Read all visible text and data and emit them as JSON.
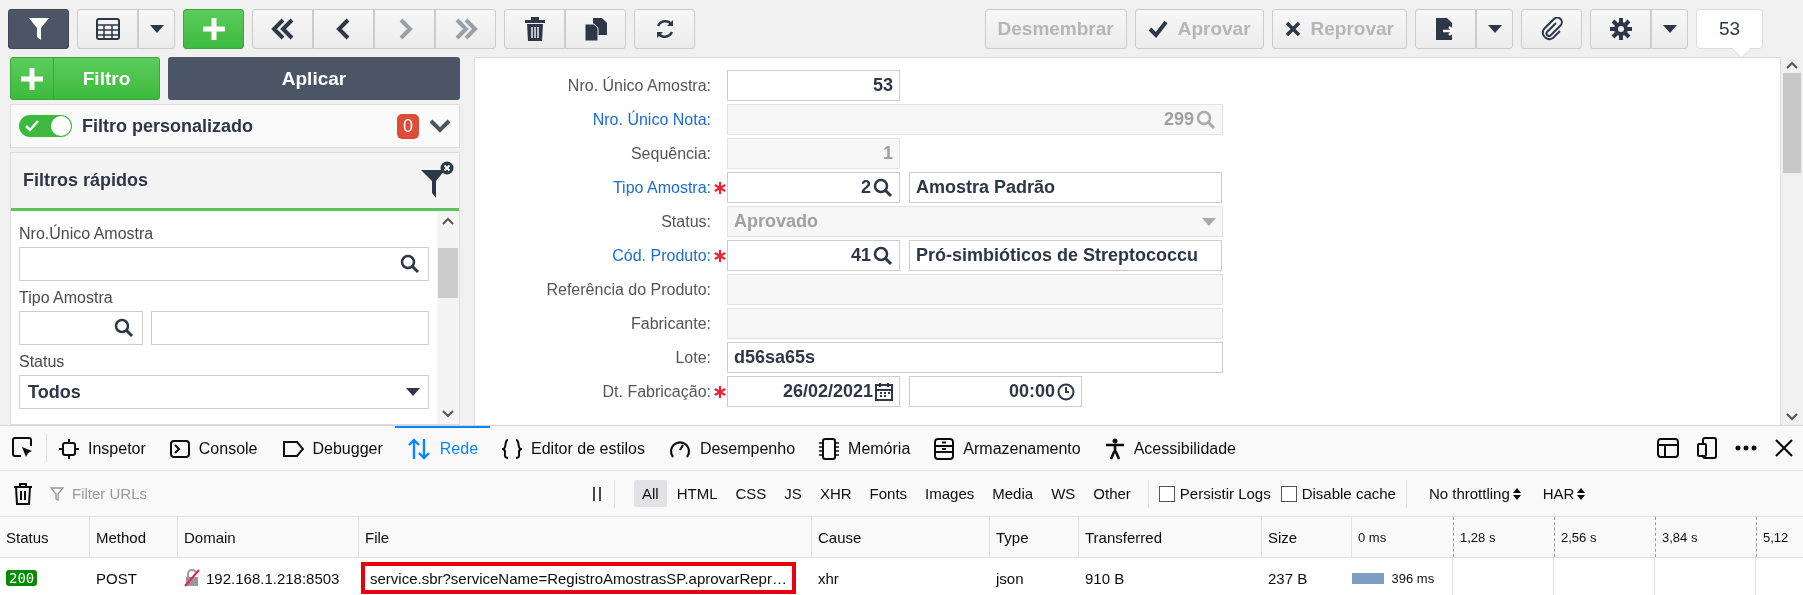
{
  "toolbar": {
    "filter_toggle": {
      "selected": true
    },
    "navigation": [
      {
        "disabled": false
      },
      {
        "disabled": false
      },
      {
        "disabled": true
      },
      {
        "disabled": true
      }
    ],
    "actions": [
      {
        "label": "Desmembrar",
        "disabled": true,
        "kind": "plain"
      },
      {
        "label": "Aprovar",
        "disabled": true,
        "kind": "check"
      },
      {
        "label": "Reprovar",
        "disabled": true,
        "kind": "cross"
      }
    ],
    "record_count": "53"
  },
  "filter_panel": {
    "add_button": "Filtro",
    "apply_button": "Aplicar",
    "custom_filter": {
      "label": "Filtro personalizado",
      "on": true,
      "count": "0"
    },
    "quick_filters": {
      "title": "Filtros rápidos",
      "fields": [
        {
          "label": "Nro.Único Amostra",
          "kind": "search"
        },
        {
          "label": "Tipo Amostra",
          "kind": "lookup_pair"
        },
        {
          "label": "Status",
          "kind": "select",
          "value": "Todos"
        }
      ]
    }
  },
  "form": {
    "fields": [
      {
        "label": "Nro. Único Amostra:",
        "link": false,
        "required": false,
        "kind": "number",
        "value": "53",
        "disabled": false
      },
      {
        "label": "Nro. Único Nota:",
        "link": true,
        "required": false,
        "kind": "lookup",
        "value": "299",
        "disabled": true
      },
      {
        "label": "Sequência:",
        "link": false,
        "required": false,
        "kind": "number",
        "value": "1",
        "disabled": true
      },
      {
        "label": "Tipo Amostra:",
        "link": true,
        "required": true,
        "kind": "lookup",
        "value": "2",
        "description": "Amostra Padrão",
        "disabled": false
      },
      {
        "label": "Status:",
        "link": false,
        "required": false,
        "kind": "select",
        "value": "Aprovado",
        "disabled": true
      },
      {
        "label": "Cód. Produto:",
        "link": true,
        "required": true,
        "kind": "lookup",
        "value": "41",
        "description": "Pró-simbióticos de Streptococcu",
        "disabled": false
      },
      {
        "label": "Referência do Produto:",
        "link": false,
        "required": false,
        "kind": "text",
        "disabled": true
      },
      {
        "label": "Fabricante:",
        "link": false,
        "required": false,
        "kind": "text",
        "disabled": true
      },
      {
        "label": "Lote:",
        "link": false,
        "required": false,
        "kind": "text",
        "value": "d56sa65s",
        "disabled": false
      },
      {
        "label": "Dt. Fabricação:",
        "link": false,
        "required": true,
        "kind": "date",
        "value": "26/02/2021",
        "time": "00:00",
        "disabled": false
      }
    ]
  },
  "devtools": {
    "tabs": [
      {
        "label": "Inspetor",
        "selected": false
      },
      {
        "label": "Console",
        "selected": false
      },
      {
        "label": "Debugger",
        "selected": false
      },
      {
        "label": "Rede",
        "selected": true
      },
      {
        "label": "Editor de estilos",
        "selected": false
      },
      {
        "label": "Desempenho",
        "selected": false
      },
      {
        "label": "Memória",
        "selected": false
      },
      {
        "label": "Armazenamento",
        "selected": false
      },
      {
        "label": "Acessibilidade",
        "selected": false
      }
    ],
    "filter": {
      "placeholder": "Filter URLs"
    },
    "type_filters": [
      {
        "label": "All",
        "selected": true
      },
      {
        "label": "HTML",
        "selected": false
      },
      {
        "label": "CSS",
        "selected": false
      },
      {
        "label": "JS",
        "selected": false
      },
      {
        "label": "XHR",
        "selected": false
      },
      {
        "label": "Fonts",
        "selected": false
      },
      {
        "label": "Images",
        "selected": false
      },
      {
        "label": "Media",
        "selected": false
      },
      {
        "label": "WS",
        "selected": false
      },
      {
        "label": "Other",
        "selected": false
      }
    ],
    "options": [
      {
        "label": "Persistir Logs",
        "checked": false
      },
      {
        "label": "Disable cache",
        "checked": false
      }
    ],
    "dropdowns": [
      "No throttling",
      "HAR"
    ],
    "table": {
      "columns": [
        "Status",
        "Method",
        "Domain",
        "File",
        "Cause",
        "Type",
        "Transferred",
        "Size"
      ],
      "timeline_ticks": [
        "0 ms",
        "1,28 s",
        "2,56 s",
        "3,84 s",
        "5,12"
      ],
      "rows": [
        {
          "status": "200",
          "method": "POST",
          "domain": "192.168.1.218:8503",
          "file": "service.sbr?serviceName=RegistroAmostrasSP.aprovarRepr…",
          "highlighted": true,
          "cause": "xhr",
          "type": "json",
          "transferred": "910 B",
          "size": "237 B",
          "timing": "396 ms",
          "level": 0.07
        }
      ]
    }
  }
}
